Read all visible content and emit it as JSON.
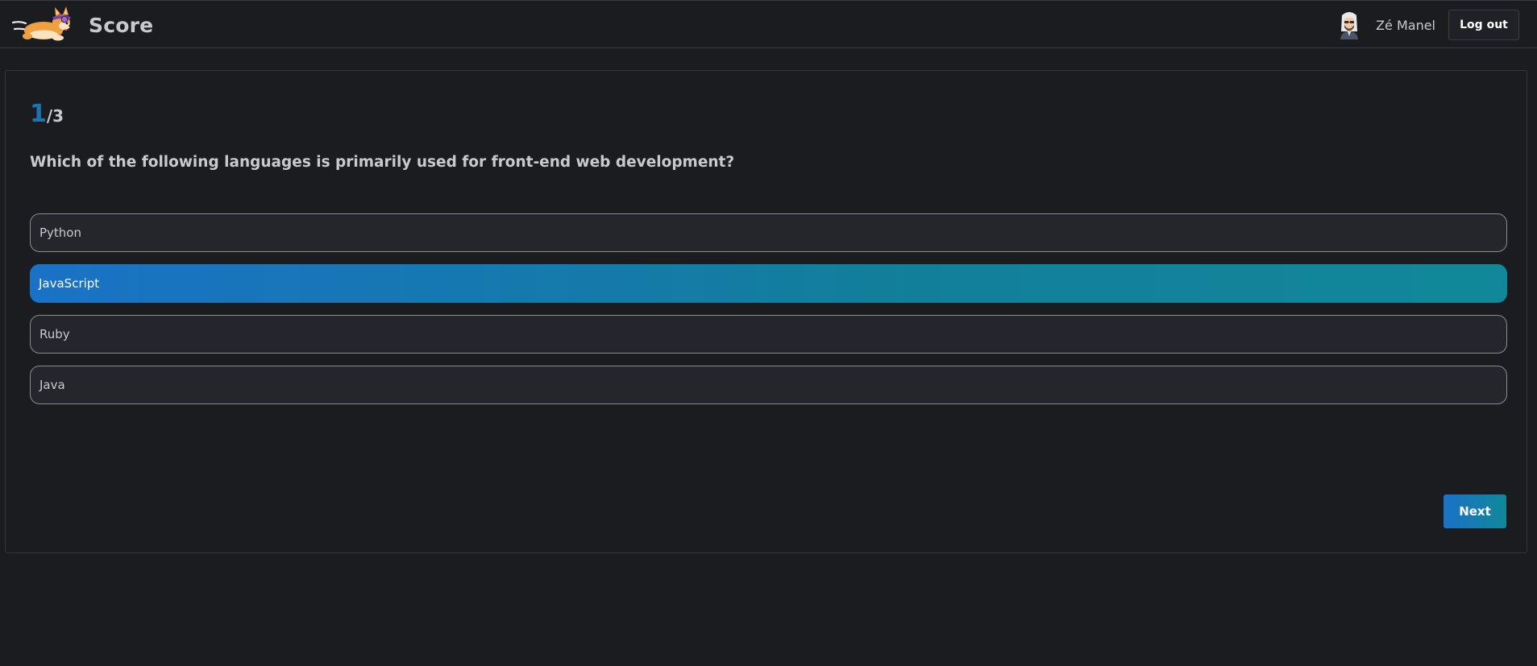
{
  "header": {
    "app_title": "Score",
    "logo_icon": "corgi-logo-icon",
    "user": {
      "name": "Zé Manel",
      "avatar_icon": "user-avatar-icon"
    },
    "logout_label": "Log out"
  },
  "quiz": {
    "current": "1",
    "total": "/3",
    "question": "Which of the following languages is primarily used for front-end web development?",
    "options": [
      {
        "label": "Python",
        "selected": false
      },
      {
        "label": "JavaScript",
        "selected": true
      },
      {
        "label": "Ruby",
        "selected": false
      },
      {
        "label": "Java",
        "selected": false
      }
    ],
    "next_label": "Next"
  },
  "colors": {
    "background": "#1b1c20",
    "accent_start": "#1a72c6",
    "accent_end": "#11889a",
    "counter_accent": "#1a74b0"
  }
}
